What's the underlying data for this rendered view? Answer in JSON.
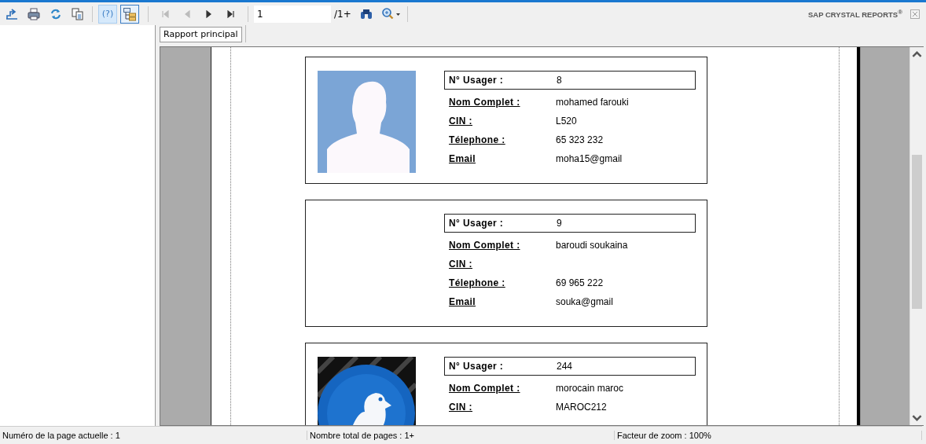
{
  "toolbar": {
    "help_label": "(?)",
    "toggles": [
      {
        "selected": false
      },
      {
        "selected": true
      }
    ],
    "nav_buttons": [
      {
        "disabled": true
      },
      {
        "disabled": true
      },
      {
        "disabled": false
      },
      {
        "disabled": false
      }
    ],
    "page_field": {
      "value": "1"
    },
    "page_total": "/1+",
    "brand": "SAP CRYSTAL REPORTS$^{®}$"
  },
  "tabs": [
    {
      "label": "Rapport principal",
      "selected": true
    }
  ],
  "cards": [
    {
      "image": {
        "kind": "picture"
      },
      "id_label": "N° Usager :",
      "id_value": "8",
      "fields": [
        {
          "label": "Nom Complet :",
          "value": "mohamed farouki"
        },
        {
          "label": "CIN :",
          "value": "L520"
        },
        {
          "label": "Télephone :",
          "value": "65 323 232"
        },
        {
          "label": "Email",
          "value": "moha15@gmail"
        }
      ]
    },
    {
      "id_label": "N° Usager :",
      "id_value": "9",
      "fields": [
        {
          "label": "Nom Complet :",
          "value": "baroudi soukaina"
        },
        {
          "label": "CIN :"
        },
        {
          "label": "Télephone :",
          "value": "69 965 222"
        },
        {
          "label": "Email",
          "value": "souka@gmail"
        }
      ]
    },
    {
      "image": {
        "kind": "picture"
      },
      "id_label": "N° Usager :",
      "id_value": "244",
      "fields": [
        {
          "label": "Nom Complet :",
          "value": "morocain maroc"
        },
        {
          "label": "CIN :",
          "value": "MAROC212"
        }
      ]
    }
  ],
  "status_bar": [
    "Numéro de la page actuelle : 1",
    "Nombre total de pages : 1+",
    "Facteur de zoom : 100%"
  ]
}
